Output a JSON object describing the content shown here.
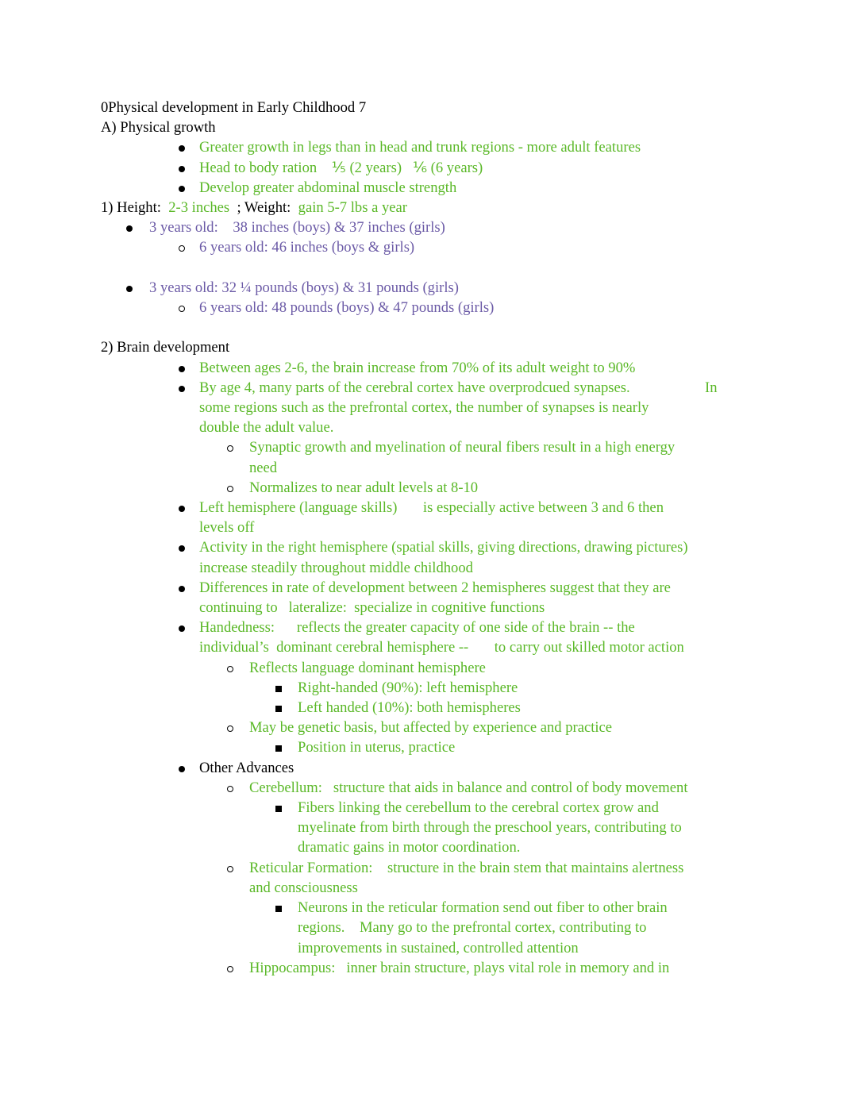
{
  "colors": {
    "green": "#5ab827",
    "purple": "#6b5aa6",
    "black": "#000000"
  },
  "title": "0Physical development in Early Childhood 7",
  "sectionA": {
    "heading": "A) Physical growth",
    "bullets": [
      "Greater growth in legs than in head and trunk regions - more adult features",
      "Head to body ration    ⅕ (2 years)   ⅙ (6 years)",
      "Develop greater abdominal muscle strength"
    ]
  },
  "height_weight": {
    "label_height": "1) Height:  ",
    "height_value": "2-3 inches",
    "label_weight": "  ; Weight:  ",
    "weight_value": "gain 5-7 lbs a year",
    "height_3": "3 years old:    38 inches (boys) & 37 inches (girls)",
    "height_6": "6 years old: 46 inches (boys & girls)",
    "weight_3": "3 years old: 32 ¼ pounds (boys) & 31 pounds (girls)",
    "weight_6": "6 years old: 48 pounds (boys) & 47 pounds (girls)"
  },
  "brain": {
    "heading": "2) Brain development",
    "b1": "Between ages 2-6, the brain increase from 70% of its adult weight to 90%",
    "b2_line1": "By age 4, many parts of the cerebral cortex have overprodcued synapses.",
    "b2_in": "In",
    "b2_rest": "some regions such as the prefrontal cortex, the number of synapses is nearly\ndouble the adult value.",
    "b2_sub1": "Synaptic growth and myelination of neural fibers result in a high energy\nneed",
    "b2_sub2": "Normalizes to near adult levels at 8-10",
    "b3": "Left hemisphere (language skills)       is especially active between 3 and 6 then\nlevels off",
    "b4": "Activity in the right hemisphere (spatial skills, giving directions, drawing pictures)\nincrease steadily throughout middle childhood",
    "b5": "Differences in rate of development between 2 hemispheres suggest that they are\ncontinuing to   lateralize:  specialize in cognitive functions",
    "b6": "Handedness:      reflects the greater capacity of one side of the brain -- the\nindividual’s  dominant cerebral hemisphere --       to carry out skilled motor action",
    "b6_sub1": "Reflects language dominant hemisphere",
    "b6_sub1_a": "Right-handed (90%): left hemisphere",
    "b6_sub1_b": "Left handed (10%): both hemispheres",
    "b6_sub2": "May be genetic basis, but affected by experience and practice",
    "b6_sub2_a": "Position in uterus, practice",
    "b7": "Other Advances",
    "cerebellum": "Cerebellum:   structure that aids in balance and control of body movement",
    "cerebellum_a": "Fibers linking the cerebellum to the cerebral cortex grow and\nmyelinate from birth through the preschool years, contributing to\ndramatic gains in motor coordination.",
    "reticular": "Reticular Formation:    structure in the brain stem that maintains alertness\nand consciousness",
    "reticular_a": "Neurons in the reticular formation send out fiber to other brain\nregions.    Many go to the prefrontal cortex, contributing to\nimprovements in sustained, controlled attention",
    "hippocampus": "Hippocampus:   inner brain structure, plays vital role in memory and in"
  }
}
